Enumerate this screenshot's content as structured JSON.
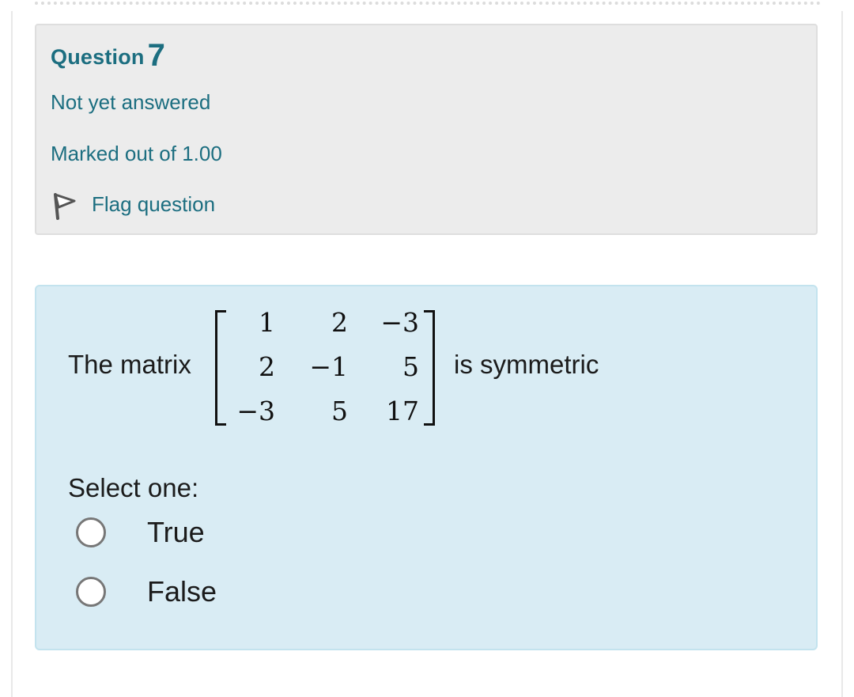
{
  "question": {
    "label": "Question",
    "number": "7",
    "state": "Not yet answered",
    "grade": "Marked out of 1.00",
    "flag_label": "Flag question"
  },
  "content": {
    "prefix": "The matrix",
    "suffix": "is symmetric",
    "matrix": [
      [
        "1",
        "2",
        "−3"
      ],
      [
        "2",
        "−1",
        "5"
      ],
      [
        "−3",
        "5",
        "17"
      ]
    ],
    "prompt": "Select one:",
    "options": [
      {
        "label": "True",
        "selected": false
      },
      {
        "label": "False",
        "selected": false
      }
    ]
  },
  "colors": {
    "accent_text": "#1c6e80",
    "info_bg": "#ececec",
    "content_bg": "#d9ecf4"
  },
  "icons": {
    "flag": "flag-icon"
  }
}
